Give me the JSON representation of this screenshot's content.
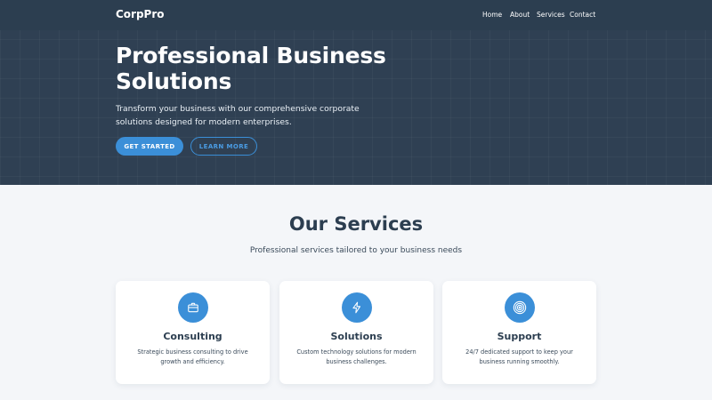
{
  "nav": {
    "brand": "CorpPro",
    "links": [
      "Home",
      "About",
      "Services",
      "Contact"
    ]
  },
  "hero": {
    "title": "Professional Business Solutions",
    "description": "Transform your business with our comprehensive corporate solutions designed for modern enterprises.",
    "primary_button": "GET STARTED",
    "secondary_button": "LEARN MORE"
  },
  "services": {
    "title": "Our Services",
    "subtitle": "Professional services tailored to your business needs",
    "cards": [
      {
        "icon": "briefcase-icon",
        "title": "Consulting",
        "text": "Strategic business consulting to drive growth and efficiency."
      },
      {
        "icon": "lightning-icon",
        "title": "Solutions",
        "text": "Custom technology solutions for modern business challenges."
      },
      {
        "icon": "target-icon",
        "title": "Support",
        "text": "24/7 dedicated support to keep your business running smoothly."
      }
    ]
  },
  "colors": {
    "hero_bg": "#2f4053",
    "navbar_bg": "#2c3e50",
    "accent": "#3b8fd8",
    "page_bg": "#f4f6f9",
    "heading": "#2c3e50"
  }
}
